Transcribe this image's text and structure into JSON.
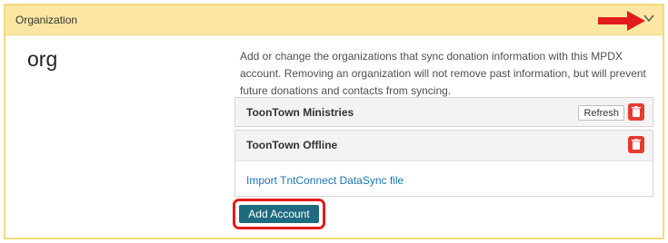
{
  "panel": {
    "title": "Organization",
    "toggle_icon": "chevron-down-icon",
    "annotation_color": "#e21c1c"
  },
  "section_label": "org",
  "description": "Add or change the organizations that sync donation information with this MPDX account. Removing an organization will not remove past information, but will prevent future donations and contacts from syncing.",
  "organizations": [
    {
      "name": "ToonTown Ministries",
      "refresh_label": "Refresh",
      "delete_icon": "trash-icon"
    },
    {
      "name": "ToonTown Offline",
      "delete_icon": "trash-icon",
      "import_link": "Import TntConnect DataSync file"
    }
  ],
  "add_button_label": "Add Account",
  "colors": {
    "header_bg": "#fbe7a3",
    "panel_border": "#f5da79",
    "delete_red": "#e63b32",
    "primary_button": "#1e6b80",
    "link": "#1a73b5"
  }
}
